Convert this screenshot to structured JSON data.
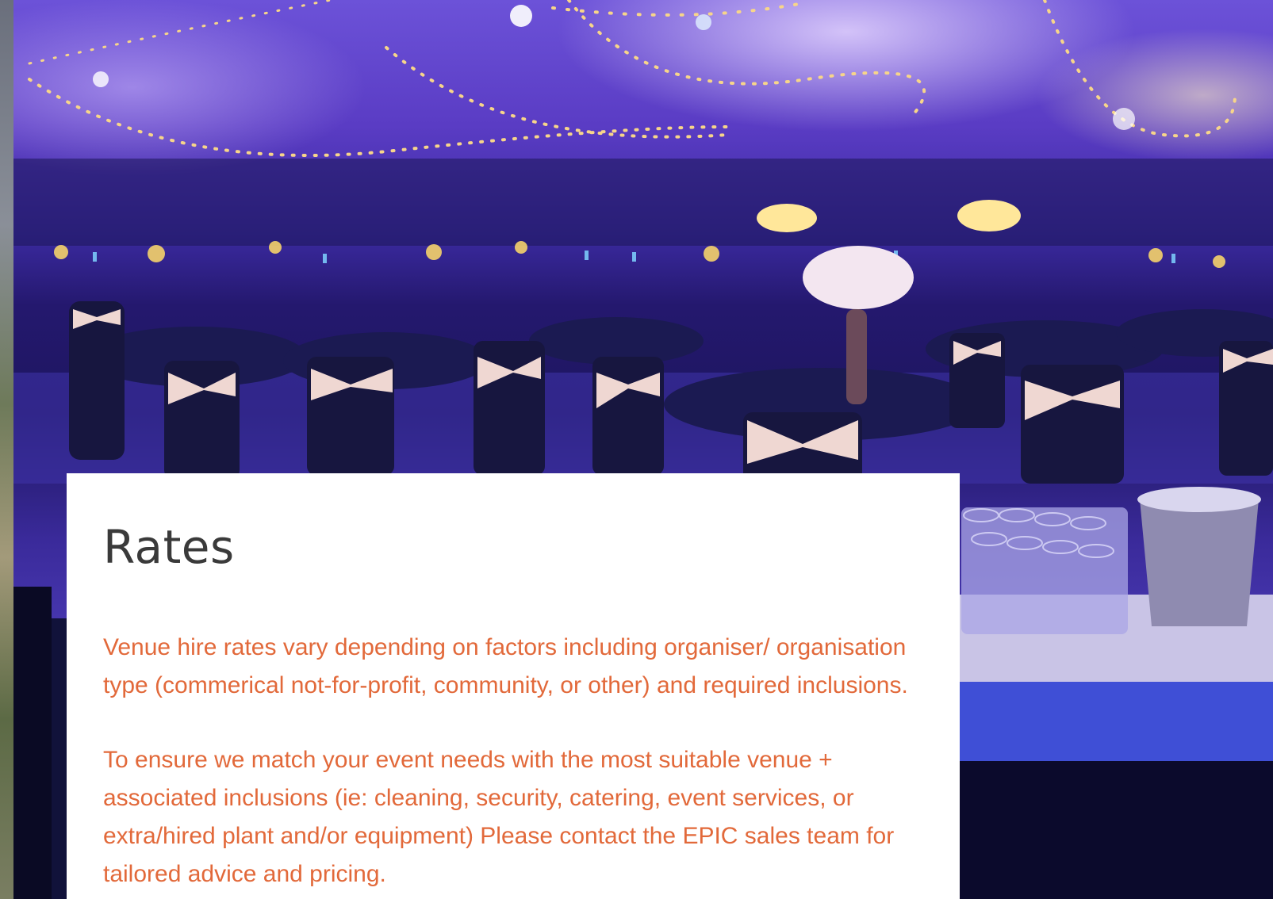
{
  "rates": {
    "title": "Rates",
    "paragraph1": "Venue hire rates vary depending on factors including organiser/ organisation type (commerical not-for-profit, community, or other) and required inclusions.",
    "paragraph2": "To ensure we match your event needs with the most suitable venue + associated inclusions (ie: cleaning, security, catering, event services, or extra/hired plant and/or equipment) Please contact the EPIC sales team for tailored advice and pricing."
  },
  "colors": {
    "heading": "#3a3a3a",
    "body_text": "#e2693a",
    "card_background": "#ffffff",
    "hero_purple": "#4c3cb8"
  }
}
